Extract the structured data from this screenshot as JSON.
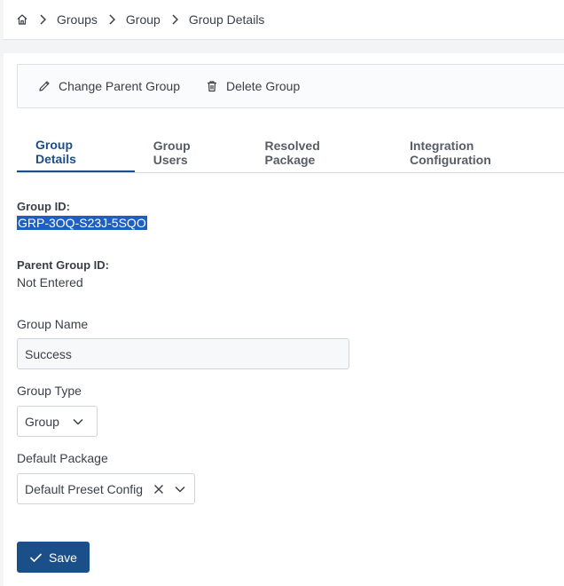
{
  "breadcrumb": {
    "home_icon": "home-icon",
    "items": [
      "Groups",
      "Group",
      "Group Details"
    ]
  },
  "toolbar": {
    "change_parent_label": "Change Parent Group",
    "delete_label": "Delete Group"
  },
  "tabs": [
    {
      "label": "Group Details",
      "active": true
    },
    {
      "label": "Group Users",
      "active": false
    },
    {
      "label": "Resolved Package",
      "active": false
    },
    {
      "label": "Integration Configuration",
      "active": false
    }
  ],
  "details": {
    "group_id_label": "Group ID:",
    "group_id_value": "GRP-3OQ-S23J-5SQO",
    "parent_group_id_label": "Parent Group ID:",
    "parent_group_id_value": "Not Entered"
  },
  "form": {
    "group_name_label": "Group Name",
    "group_name_value": "Success",
    "group_type_label": "Group Type",
    "group_type_value": "Group",
    "default_package_label": "Default Package",
    "default_package_value": "Default Preset Config"
  },
  "actions": {
    "save_label": "Save"
  },
  "colors": {
    "accent": "#1b4f8a",
    "selection": "#1f5fbf"
  }
}
